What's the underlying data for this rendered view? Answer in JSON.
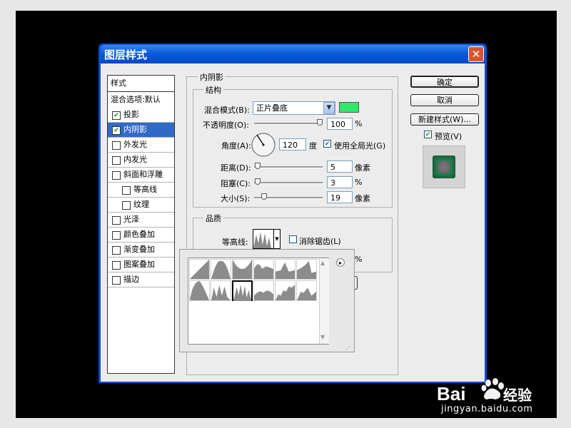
{
  "dialog": {
    "title": "图层样式",
    "close_glyph": "✕"
  },
  "styles_list": {
    "header": "样式",
    "blend_options": "混合选项:默认",
    "items": [
      {
        "label": "投影",
        "checked": true,
        "selected": false,
        "indent": false
      },
      {
        "label": "内阴影",
        "checked": true,
        "selected": true,
        "indent": false
      },
      {
        "label": "外发光",
        "checked": false,
        "selected": false,
        "indent": false
      },
      {
        "label": "内发光",
        "checked": false,
        "selected": false,
        "indent": false
      },
      {
        "label": "斜面和浮雕",
        "checked": false,
        "selected": false,
        "indent": false
      },
      {
        "label": "等高线",
        "checked": false,
        "selected": false,
        "indent": true
      },
      {
        "label": "纹理",
        "checked": false,
        "selected": false,
        "indent": true
      },
      {
        "label": "光泽",
        "checked": false,
        "selected": false,
        "indent": false
      },
      {
        "label": "颜色叠加",
        "checked": false,
        "selected": false,
        "indent": false
      },
      {
        "label": "渐变叠加",
        "checked": false,
        "selected": false,
        "indent": false
      },
      {
        "label": "图案叠加",
        "checked": false,
        "selected": false,
        "indent": false
      },
      {
        "label": "描边",
        "checked": false,
        "selected": false,
        "indent": false
      }
    ]
  },
  "inner_shadow": {
    "section_title": "内阴影",
    "structure_title": "结构",
    "blend_mode_label": "混合模式(B):",
    "blend_mode_value": "正片叠底",
    "color_swatch": "#2ee86e",
    "opacity_label": "不透明度(O):",
    "opacity_value": "100",
    "opacity_unit": "%",
    "opacity_level": 1.0,
    "angle_label": "角度(A):",
    "angle_value": "120",
    "angle_unit": "度",
    "global_light_label": "使用全局光(G)",
    "global_light_checked": true,
    "distance_label": "距离(D):",
    "distance_value": "5",
    "distance_unit": "像素",
    "choke_label": "阻塞(C):",
    "choke_value": "3",
    "choke_unit": "%",
    "size_label": "大小(S):",
    "size_value": "19",
    "size_unit": "像素",
    "quality_title": "品质",
    "contour_label": "等高线:",
    "antialias_label": "消除锯齿(L)",
    "antialias_checked": false,
    "noise_unit": "%"
  },
  "buttons": {
    "ok": "确定",
    "cancel": "取消",
    "new_style": "新建样式(W)...",
    "preview_label": "预览(V)",
    "preview_checked": true
  },
  "contour_picker": {
    "menu_arrow": "▸",
    "count": 12,
    "selected_index": 8
  },
  "watermark": {
    "brand": "Baidu经验",
    "url": "jingyan.baidu.com"
  }
}
